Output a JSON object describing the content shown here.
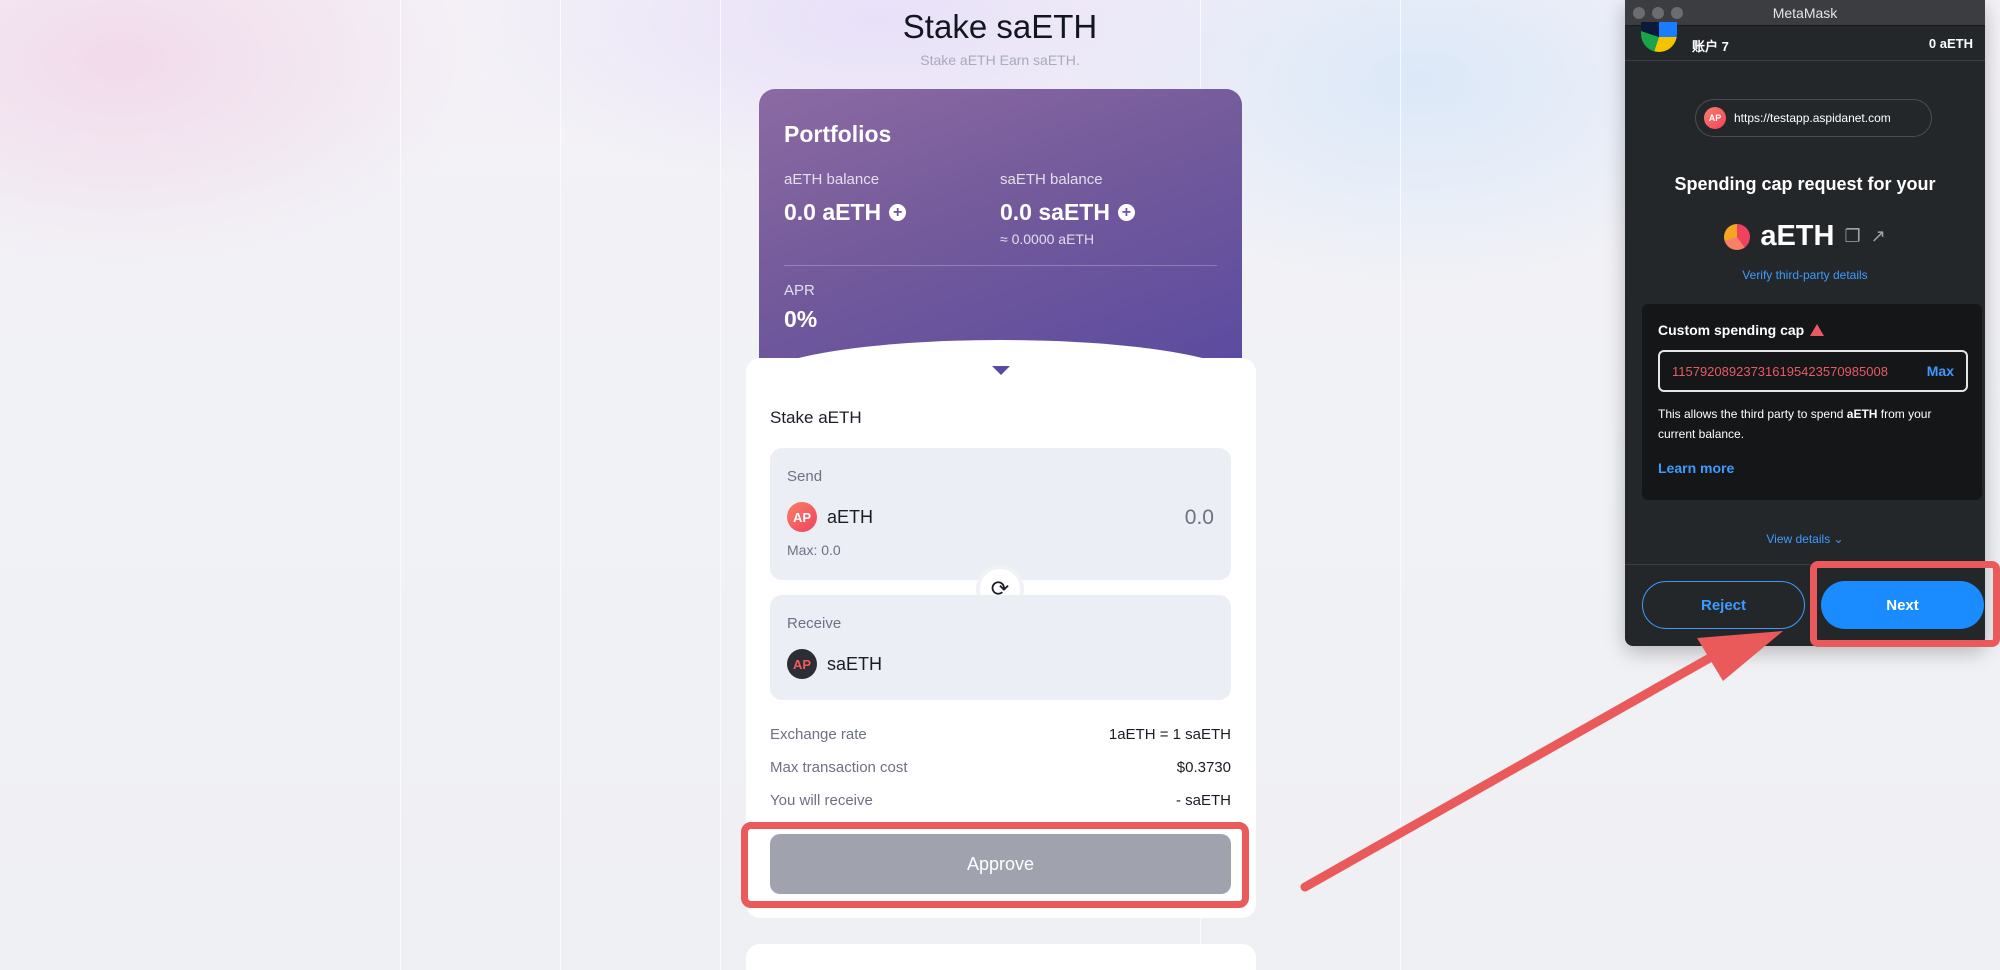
{
  "page": {
    "title": "Stake saETH",
    "subtitle": "Stake aETH Earn saETH."
  },
  "portfolio": {
    "title": "Portfolios",
    "aeth_label": "aETH balance",
    "aeth_value": "0.0 aETH",
    "saeth_label": "saETH balance",
    "saeth_value": "0.0 saETH",
    "saeth_equiv": "≈ 0.0000 aETH",
    "apr_label": "APR",
    "apr_value": "0%"
  },
  "stake": {
    "title": "Stake aETH",
    "send_label": "Send",
    "send_token": "aETH",
    "send_amount": "0.0",
    "max_text": "Max: 0.0",
    "receive_label": "Receive",
    "receive_token": "saETH",
    "rows": [
      {
        "label": "Exchange rate",
        "value": "1aETH = 1 saETH"
      },
      {
        "label": "Max transaction cost",
        "value": "$0.3730"
      },
      {
        "label": "You will receive",
        "value": "- saETH"
      }
    ],
    "approve_label": "Approve"
  },
  "metamask": {
    "window_title": "MetaMask",
    "account": "账户 7",
    "balance": "0 aETH",
    "site_url": "https://testapp.aspidanet.com",
    "heading": "Spending cap request for your",
    "token": "aETH",
    "verify_link": "Verify third-party details",
    "cap_label": "Custom spending cap",
    "cap_value": "115792089237316195423570985008",
    "max_label": "Max",
    "desc_prefix": "This allows the third party to spend ",
    "desc_token": "aETH",
    "desc_suffix": " from your current balance.",
    "learn_more": "Learn more",
    "view_details": "View details",
    "reject_label": "Reject",
    "next_label": "Next"
  },
  "colors": {
    "accent_blue": "#1a8cff",
    "highlight_red": "#eb5a5a",
    "portfolio_purple": "#735a9b"
  }
}
